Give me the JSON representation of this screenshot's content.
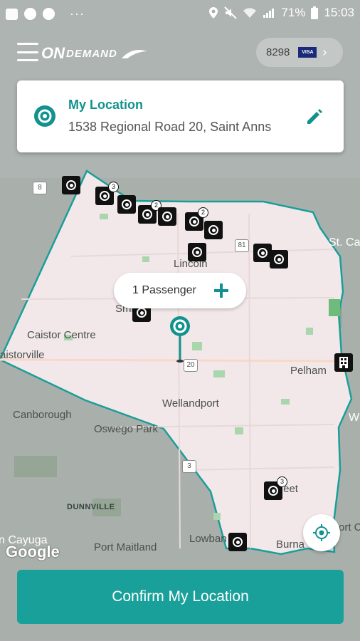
{
  "status_bar": {
    "battery": "71%",
    "time": "15:03",
    "overflow": "···",
    "icons": [
      "gallery-icon",
      "smiley-icon",
      "smiley-icon",
      "location-icon",
      "mute-icon",
      "wifi-icon",
      "signal-icon",
      "battery-icon"
    ]
  },
  "header": {
    "logo_on": "ON",
    "logo_demand": "DEMAND",
    "payment_last4": "8298",
    "card_brand": "VISA"
  },
  "location_card": {
    "title": "My Location",
    "address": "1538 Regional Road 20, Saint Anns"
  },
  "passenger": {
    "label": "1 Passenger"
  },
  "map": {
    "labels": {
      "caistor_centre": "Caistor Centre",
      "caistorville": "aistorville",
      "canborough": "Canborough",
      "oswego_park": "Oswego Park",
      "wellandport": "Wellandport",
      "pelham": "Pelham",
      "dunnville": "DUNNVILLE",
      "port_maitland": "Port Maitland",
      "cayuga": "n Cayuga",
      "lowbanks": "Lowban",
      "burnaby": "Burna",
      "port_c": "Port C",
      "wainfleet": "Wa    eet",
      "st_c": "St. Ca",
      "lincoln": "Lincoln",
      "smithville": "Smi      ille",
      "pelham_right": "W"
    },
    "roads": {
      "r8": "8",
      "r81": "81",
      "r20": "20",
      "r3": "3"
    },
    "stop_counts": {
      "a": "3",
      "b": "2",
      "c": "2",
      "d": "3"
    },
    "google": "Google",
    "colors": {
      "service_area": "#f2e8e9",
      "outside": "#a9b0ac",
      "boundary": "#1a9e98",
      "accent": "#12928e"
    }
  },
  "confirm_button": {
    "label": "Confirm My Location"
  }
}
